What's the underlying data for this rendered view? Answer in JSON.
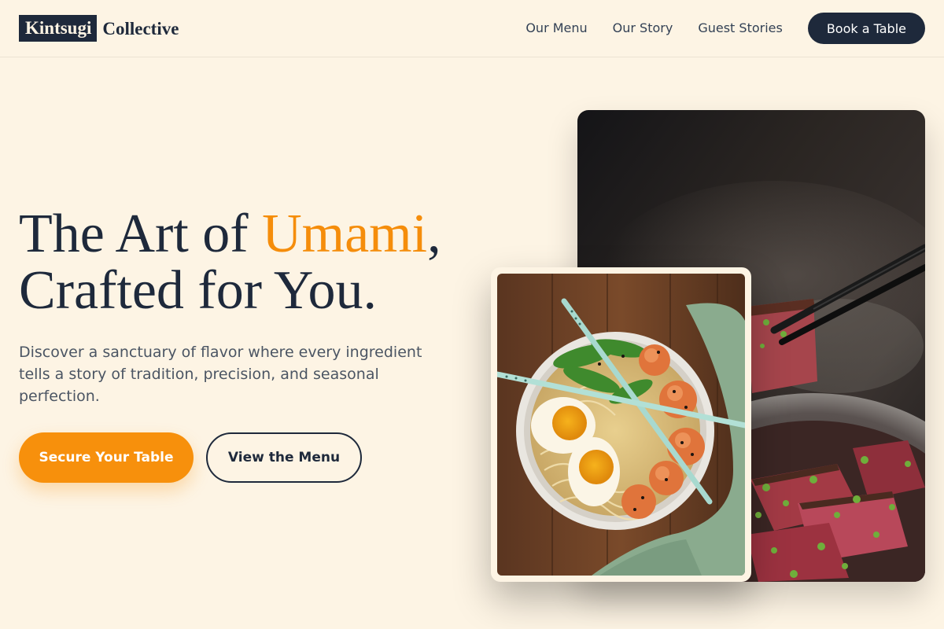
{
  "brand": {
    "box_text": "Kintsugi",
    "text": "Collective"
  },
  "nav": {
    "links": [
      {
        "label": "Our Menu"
      },
      {
        "label": "Our Story"
      },
      {
        "label": "Guest Stories"
      }
    ],
    "cta_label": "Book a Table"
  },
  "hero": {
    "title_part1": "The Art of ",
    "title_accent": "Umami",
    "title_part2": ",",
    "title_line2": "Crafted for You.",
    "subtitle": "Discover a sanctuary of flavor where every ingredient tells a story of tradition, precision, and seasonal perfection.",
    "primary_button": "Secure Your Table",
    "secondary_button": "View the Menu"
  },
  "colors": {
    "background": "#fdf4e4",
    "navy": "#1e293b",
    "accent": "#f58d0b"
  },
  "images": {
    "back_photo": "seared-wagyu-with-chopsticks",
    "front_photo": "ramen-bowl-with-shrimp-and-eggs"
  }
}
